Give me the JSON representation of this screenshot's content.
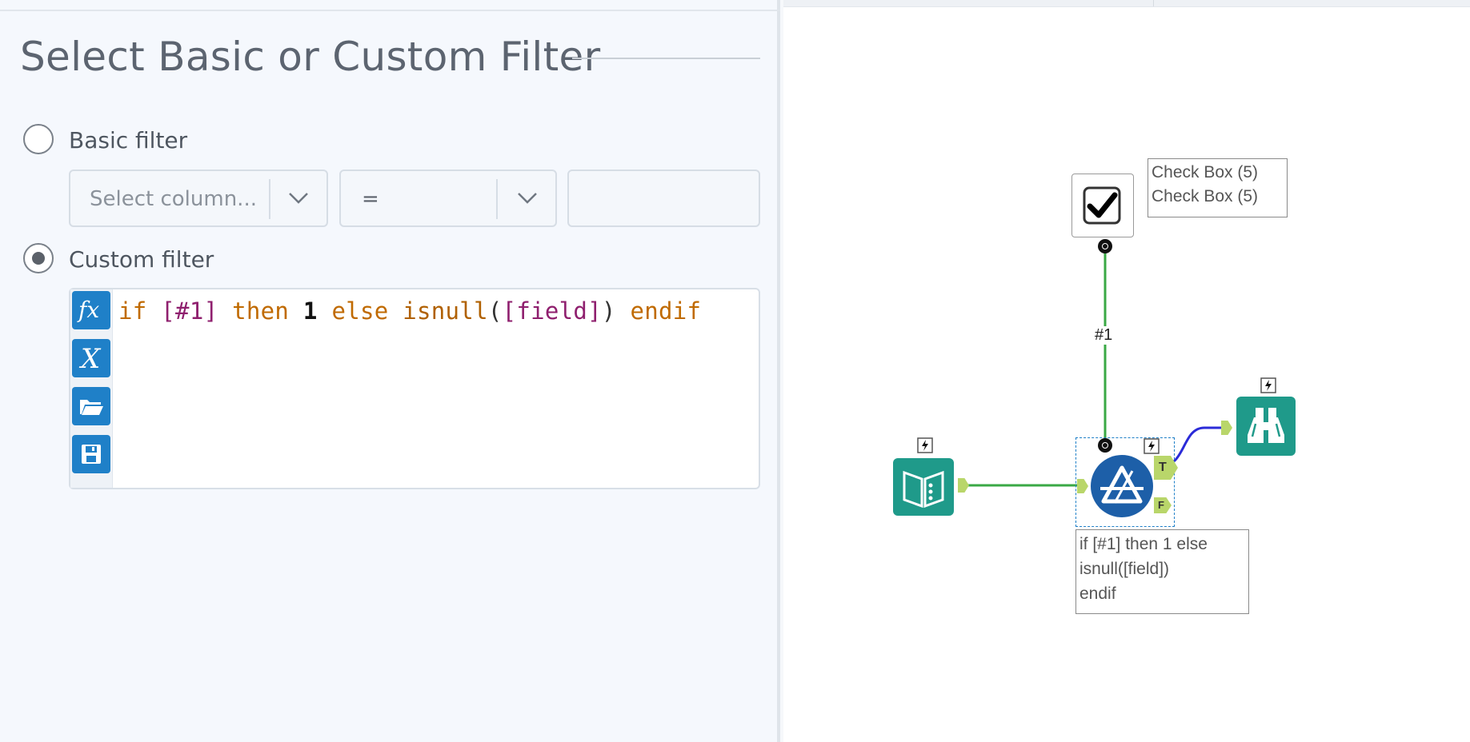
{
  "config": {
    "section_title": "Select Basic or Custom Filter",
    "basic_filter": {
      "label": "Basic filter",
      "selected": false,
      "column_placeholder": "Select column...",
      "operator_value": "=",
      "value_text": ""
    },
    "custom_filter": {
      "label": "Custom filter",
      "selected": true,
      "expression_tokens": {
        "if": "if",
        "field1": "[#1]",
        "then": "then",
        "one": "1",
        "else": "else",
        "isnull": "isnull",
        "open": "(",
        "field": "[field]",
        "close": ")",
        "endif": "endif"
      },
      "gutter_buttons": [
        "function-icon",
        "variable-icon",
        "open-folder-icon",
        "save-icon"
      ]
    }
  },
  "canvas": {
    "checkbox_tool": {
      "icon": "checkmark-icon",
      "annotation_lines": [
        "Check Box (5)",
        "Check Box (5)"
      ]
    },
    "connection_label": "#1",
    "input_tool": {
      "icon": "book-icon"
    },
    "filter_tool": {
      "icon": "filter-triangle-icon",
      "true_anchor": "T",
      "false_anchor": "F",
      "annotation_lines": [
        "if [#1] then 1 else",
        "isnull([field])",
        "endif"
      ]
    },
    "browse_tool": {
      "icon": "binoculars-icon"
    }
  },
  "colors": {
    "accent_blue": "#1f80c8",
    "tool_teal": "#1f9a8a",
    "connector_green": "#3aa845",
    "connector_blue": "#2b2bd8",
    "anchor_lime": "#b9d66a",
    "keyword": "#c06a00",
    "field": "#8f1f6e"
  }
}
